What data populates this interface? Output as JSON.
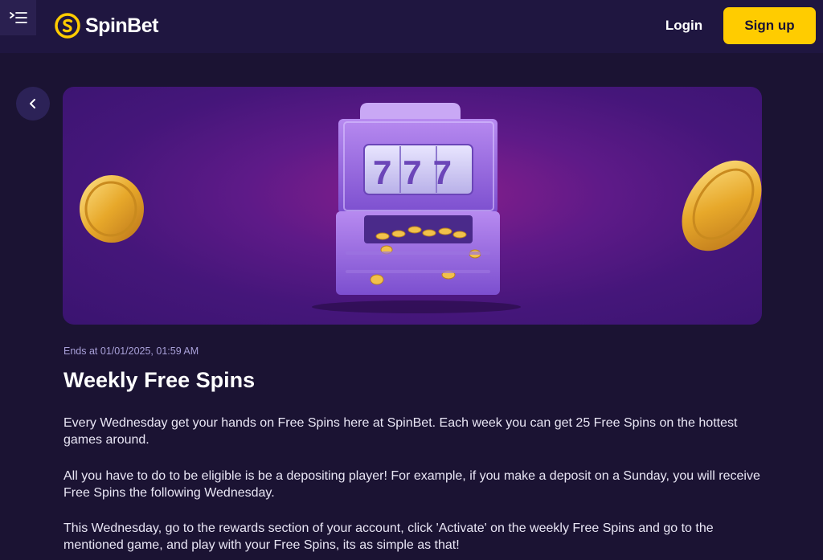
{
  "header": {
    "brand": "SpinBet",
    "login_label": "Login",
    "signup_label": "Sign up",
    "menu_icon": "menu-collapse-icon",
    "logo_icon": "spinbet-logo-icon"
  },
  "back": {
    "icon": "chevron-left-icon"
  },
  "banner": {
    "reel_text": "777",
    "icons": [
      "slot-machine-icon",
      "gold-coin-icon"
    ]
  },
  "promo": {
    "ends_at": "Ends at 01/01/2025, 01:59 AM",
    "title": "Weekly Free Spins",
    "paragraphs": [
      "Every Wednesday get your hands on Free Spins here at SpinBet. Each week you can get 25 Free Spins on the hottest games around.",
      "All you have to do to be eligible is be a depositing player! For example, if you make a deposit on a Sunday, you will receive Free Spins the following Wednesday.",
      "This Wednesday, go to the rewards section of your account, click 'Activate' on the weekly Free Spins and go to the mentioned game, and play with your Free Spins, its as simple as that!"
    ]
  },
  "colors": {
    "page_bg": "#1b1333",
    "header_bg": "#1f1640",
    "accent": "#ffcc00",
    "muted_text": "#a8a0d8"
  }
}
